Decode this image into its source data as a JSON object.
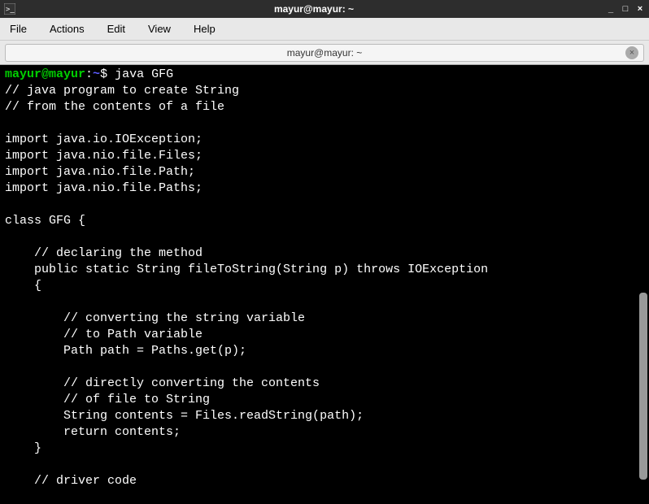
{
  "titlebar": {
    "title": "mayur@mayur: ~"
  },
  "window_controls": {
    "minimize": "_",
    "maximize": "□",
    "close": "×"
  },
  "menubar": {
    "file": "File",
    "actions": "Actions",
    "edit": "Edit",
    "view": "View",
    "help": "Help"
  },
  "tab": {
    "label": "mayur@mayur: ~"
  },
  "prompt": {
    "user_host": "mayur@mayur",
    "colon": ":",
    "path": "~",
    "dollar": "$ "
  },
  "command": "java GFG",
  "output_lines": [
    "// java program to create String",
    "// from the contents of a file",
    "",
    "import java.io.IOException;",
    "import java.nio.file.Files;",
    "import java.nio.file.Path;",
    "import java.nio.file.Paths;",
    "",
    "class GFG {",
    "",
    "    // declaring the method",
    "    public static String fileToString(String p) throws IOException",
    "    {",
    "",
    "        // converting the string variable",
    "        // to Path variable",
    "        Path path = Paths.get(p);",
    "",
    "        // directly converting the contents",
    "        // of file to String",
    "        String contents = Files.readString(path);",
    "        return contents;",
    "    }",
    "",
    "    // driver code"
  ]
}
